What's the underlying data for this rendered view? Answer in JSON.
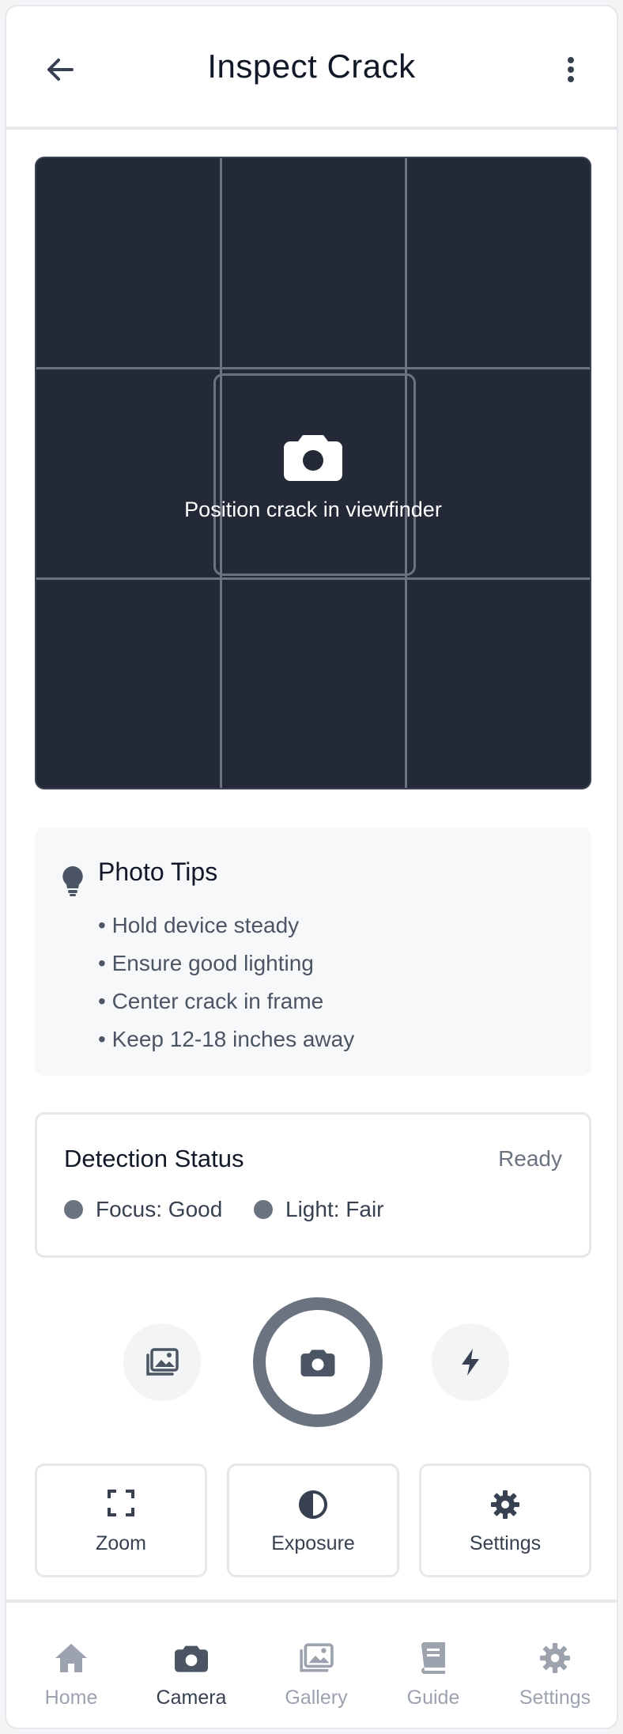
{
  "header": {
    "title": "Inspect Crack",
    "back_icon": "arrow-left-icon",
    "more_icon": "more-vertical-icon"
  },
  "viewfinder": {
    "icon": "camera-icon",
    "hint": "Position crack in viewfinder"
  },
  "tips": {
    "icon": "lightbulb-icon",
    "title": "Photo Tips",
    "items": [
      "• Hold device steady",
      "• Ensure good lighting",
      "• Center crack in frame",
      "• Keep 12-18 inches away"
    ]
  },
  "detection": {
    "title": "Detection Status",
    "status": "Ready",
    "focus": "Focus: Good",
    "light": "Light: Fair"
  },
  "controls": {
    "gallery_icon": "images-icon",
    "shutter_icon": "camera-icon",
    "flash_icon": "bolt-icon"
  },
  "options": [
    {
      "label": "Zoom",
      "icon": "expand-icon"
    },
    {
      "label": "Exposure",
      "icon": "contrast-icon"
    },
    {
      "label": "Settings",
      "icon": "gear-icon"
    }
  ],
  "nav": {
    "active": "Camera",
    "items": [
      {
        "label": "Home",
        "icon": "home-icon"
      },
      {
        "label": "Camera",
        "icon": "camera-icon"
      },
      {
        "label": "Gallery",
        "icon": "images-icon"
      },
      {
        "label": "Guide",
        "icon": "book-icon"
      },
      {
        "label": "Settings",
        "icon": "gear-icon"
      }
    ]
  },
  "colors": {
    "viewfinder_bg": "#232936",
    "accent_gray": "#6b7280",
    "border": "#e5e7eb"
  }
}
